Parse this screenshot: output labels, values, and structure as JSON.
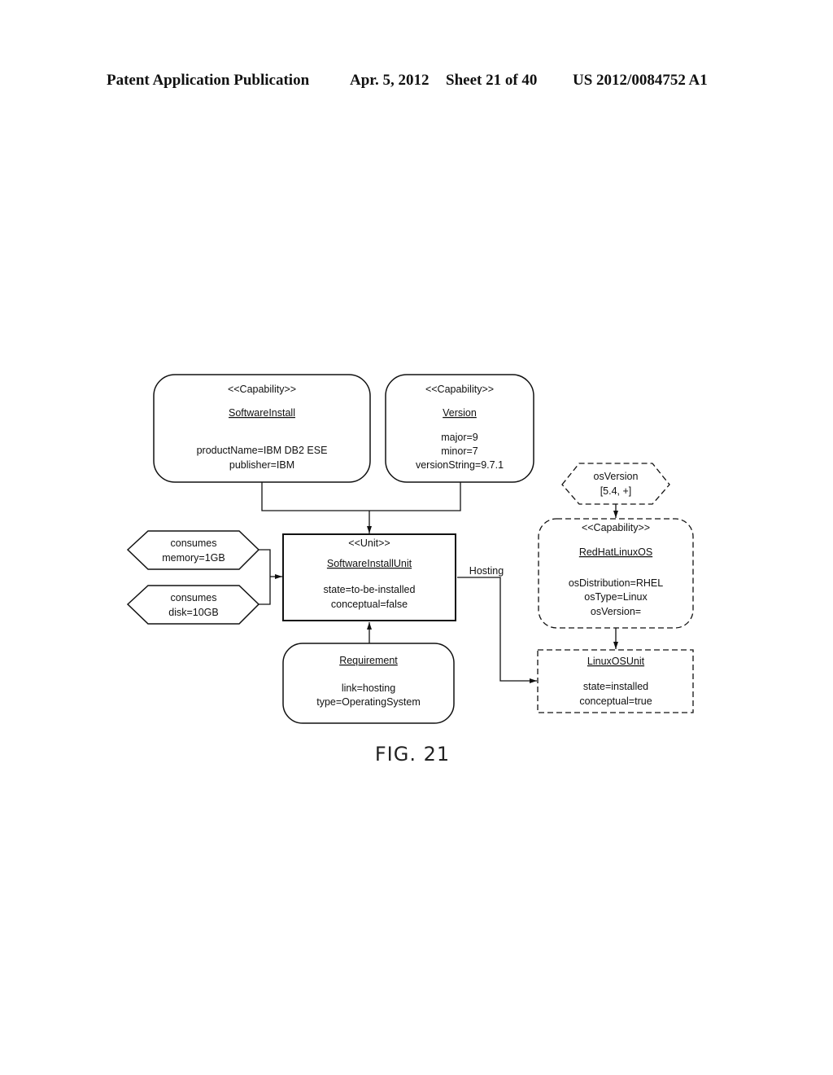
{
  "header": {
    "publication": "Patent Application Publication",
    "date": "Apr. 5, 2012",
    "sheet": "Sheet 21 of 40",
    "number": "US 2012/0084752 A1"
  },
  "diagram": {
    "software_install": {
      "stereotype": "<<Capability>>",
      "name": "SoftwareInstall",
      "attrs": [
        "productName=IBM DB2 ESE",
        "publisher=IBM"
      ]
    },
    "version": {
      "stereotype": "<<Capability>>",
      "name": "Version",
      "attrs": [
        "major=9",
        "minor=7",
        "versionString=9.7.1"
      ]
    },
    "os_version_constraint": {
      "line1": "osVersion",
      "line2": "[5.4, +]"
    },
    "redhat_linux_os": {
      "stereotype": "<<Capability>>",
      "name": "RedHatLinuxOS",
      "attrs": [
        "osDistribution=RHEL",
        "osType=Linux",
        "osVersion="
      ]
    },
    "consumes_memory": {
      "line1": "consumes",
      "line2": "memory=1GB"
    },
    "consumes_disk": {
      "line1": "consumes",
      "line2": "disk=10GB"
    },
    "software_install_unit": {
      "stereotype": "<<Unit>>",
      "name": "SoftwareInstallUnit",
      "attrs": [
        "state=to-be-installed",
        "conceptual=false"
      ]
    },
    "hosting_label": "Hosting",
    "requirement": {
      "name": "Requirement",
      "attrs": [
        "link=hosting",
        "type=OperatingSystem"
      ]
    },
    "linux_os_unit": {
      "name": "LinuxOSUnit",
      "attrs": [
        "state=installed",
        "conceptual=true"
      ]
    },
    "figure_label": "FIG. 21"
  }
}
